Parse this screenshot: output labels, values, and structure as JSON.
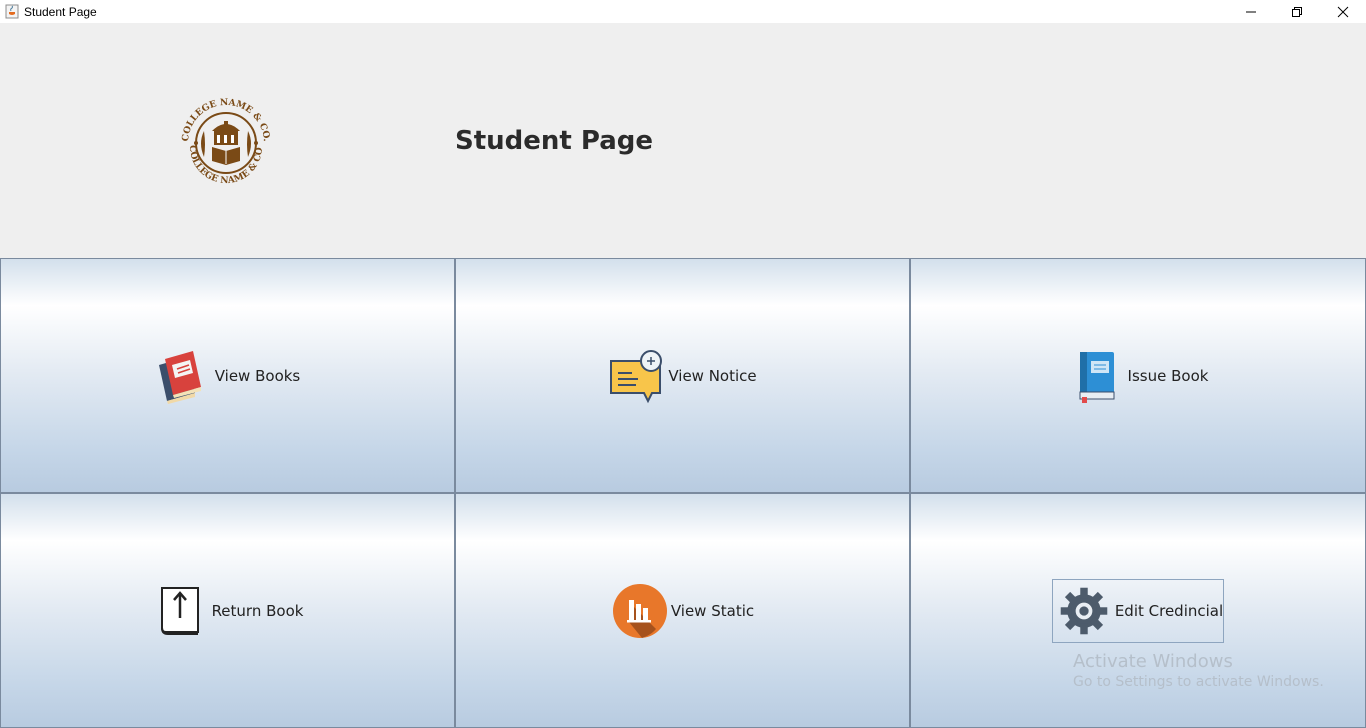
{
  "window": {
    "title": "Student Page",
    "icon": "java-cup-icon",
    "controls": [
      "minimize-icon",
      "restore-icon",
      "close-icon"
    ]
  },
  "header": {
    "title": "Student Page",
    "logo": {
      "icon": "college-seal-icon",
      "text": "COLLEGE NAME & CO.",
      "color": "#7a4a16"
    }
  },
  "tiles": [
    {
      "label": "View Books",
      "icon": "books-icon"
    },
    {
      "label": "View Notice",
      "icon": "notice-message-icon"
    },
    {
      "label": "Issue Book",
      "icon": "blue-book-icon"
    },
    {
      "label": "Return Book",
      "icon": "return-book-icon"
    },
    {
      "label": "View Static",
      "icon": "bar-chart-icon"
    },
    {
      "label": "Edit Credincial",
      "icon": "gear-icon"
    }
  ],
  "watermark": {
    "line1": "Activate Windows",
    "line2": "Go to Settings to activate Windows."
  },
  "colors": {
    "tile_border": "#7a8a9e",
    "title_text": "#2b2b2b",
    "background": "#efefef"
  }
}
